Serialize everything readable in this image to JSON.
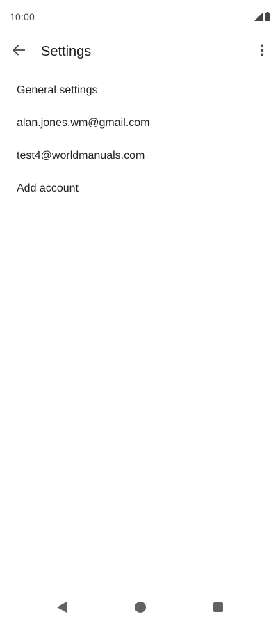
{
  "status_bar": {
    "time": "10:00",
    "icons": [
      "signal-icon",
      "battery-icon"
    ]
  },
  "app_bar": {
    "title": "Settings",
    "back_icon": "arrow-back-icon",
    "menu_icon": "more-vert-icon"
  },
  "settings": {
    "items": [
      {
        "label": "General settings"
      },
      {
        "label": "alan.jones.wm@gmail.com"
      },
      {
        "label": "test4@worldmanuals.com"
      },
      {
        "label": "Add account"
      }
    ]
  },
  "nav_bar": {
    "buttons": [
      "nav-back-icon",
      "nav-home-icon",
      "nav-recents-icon"
    ]
  },
  "colors": {
    "background": "#ffffff",
    "text_primary": "#1f1f1f",
    "text_secondary": "#444746",
    "icon": "#444746",
    "nav_icon": "#5f6368"
  }
}
